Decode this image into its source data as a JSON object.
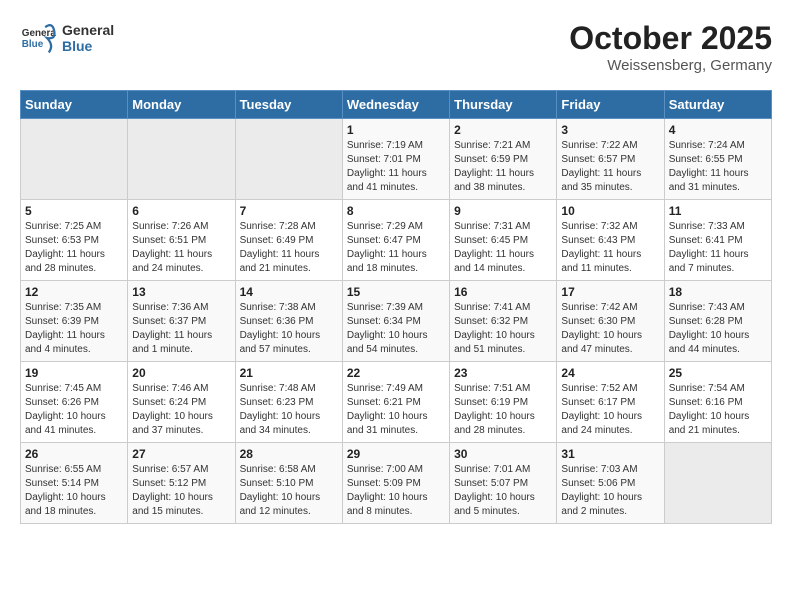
{
  "header": {
    "logo_line1": "General",
    "logo_line2": "Blue",
    "month": "October 2025",
    "location": "Weissensberg, Germany"
  },
  "weekdays": [
    "Sunday",
    "Monday",
    "Tuesday",
    "Wednesday",
    "Thursday",
    "Friday",
    "Saturday"
  ],
  "weeks": [
    [
      {
        "day": "",
        "info": ""
      },
      {
        "day": "",
        "info": ""
      },
      {
        "day": "",
        "info": ""
      },
      {
        "day": "1",
        "info": "Sunrise: 7:19 AM\nSunset: 7:01 PM\nDaylight: 11 hours and 41 minutes."
      },
      {
        "day": "2",
        "info": "Sunrise: 7:21 AM\nSunset: 6:59 PM\nDaylight: 11 hours and 38 minutes."
      },
      {
        "day": "3",
        "info": "Sunrise: 7:22 AM\nSunset: 6:57 PM\nDaylight: 11 hours and 35 minutes."
      },
      {
        "day": "4",
        "info": "Sunrise: 7:24 AM\nSunset: 6:55 PM\nDaylight: 11 hours and 31 minutes."
      }
    ],
    [
      {
        "day": "5",
        "info": "Sunrise: 7:25 AM\nSunset: 6:53 PM\nDaylight: 11 hours and 28 minutes."
      },
      {
        "day": "6",
        "info": "Sunrise: 7:26 AM\nSunset: 6:51 PM\nDaylight: 11 hours and 24 minutes."
      },
      {
        "day": "7",
        "info": "Sunrise: 7:28 AM\nSunset: 6:49 PM\nDaylight: 11 hours and 21 minutes."
      },
      {
        "day": "8",
        "info": "Sunrise: 7:29 AM\nSunset: 6:47 PM\nDaylight: 11 hours and 18 minutes."
      },
      {
        "day": "9",
        "info": "Sunrise: 7:31 AM\nSunset: 6:45 PM\nDaylight: 11 hours and 14 minutes."
      },
      {
        "day": "10",
        "info": "Sunrise: 7:32 AM\nSunset: 6:43 PM\nDaylight: 11 hours and 11 minutes."
      },
      {
        "day": "11",
        "info": "Sunrise: 7:33 AM\nSunset: 6:41 PM\nDaylight: 11 hours and 7 minutes."
      }
    ],
    [
      {
        "day": "12",
        "info": "Sunrise: 7:35 AM\nSunset: 6:39 PM\nDaylight: 11 hours and 4 minutes."
      },
      {
        "day": "13",
        "info": "Sunrise: 7:36 AM\nSunset: 6:37 PM\nDaylight: 11 hours and 1 minute."
      },
      {
        "day": "14",
        "info": "Sunrise: 7:38 AM\nSunset: 6:36 PM\nDaylight: 10 hours and 57 minutes."
      },
      {
        "day": "15",
        "info": "Sunrise: 7:39 AM\nSunset: 6:34 PM\nDaylight: 10 hours and 54 minutes."
      },
      {
        "day": "16",
        "info": "Sunrise: 7:41 AM\nSunset: 6:32 PM\nDaylight: 10 hours and 51 minutes."
      },
      {
        "day": "17",
        "info": "Sunrise: 7:42 AM\nSunset: 6:30 PM\nDaylight: 10 hours and 47 minutes."
      },
      {
        "day": "18",
        "info": "Sunrise: 7:43 AM\nSunset: 6:28 PM\nDaylight: 10 hours and 44 minutes."
      }
    ],
    [
      {
        "day": "19",
        "info": "Sunrise: 7:45 AM\nSunset: 6:26 PM\nDaylight: 10 hours and 41 minutes."
      },
      {
        "day": "20",
        "info": "Sunrise: 7:46 AM\nSunset: 6:24 PM\nDaylight: 10 hours and 37 minutes."
      },
      {
        "day": "21",
        "info": "Sunrise: 7:48 AM\nSunset: 6:23 PM\nDaylight: 10 hours and 34 minutes."
      },
      {
        "day": "22",
        "info": "Sunrise: 7:49 AM\nSunset: 6:21 PM\nDaylight: 10 hours and 31 minutes."
      },
      {
        "day": "23",
        "info": "Sunrise: 7:51 AM\nSunset: 6:19 PM\nDaylight: 10 hours and 28 minutes."
      },
      {
        "day": "24",
        "info": "Sunrise: 7:52 AM\nSunset: 6:17 PM\nDaylight: 10 hours and 24 minutes."
      },
      {
        "day": "25",
        "info": "Sunrise: 7:54 AM\nSunset: 6:16 PM\nDaylight: 10 hours and 21 minutes."
      }
    ],
    [
      {
        "day": "26",
        "info": "Sunrise: 6:55 AM\nSunset: 5:14 PM\nDaylight: 10 hours and 18 minutes."
      },
      {
        "day": "27",
        "info": "Sunrise: 6:57 AM\nSunset: 5:12 PM\nDaylight: 10 hours and 15 minutes."
      },
      {
        "day": "28",
        "info": "Sunrise: 6:58 AM\nSunset: 5:10 PM\nDaylight: 10 hours and 12 minutes."
      },
      {
        "day": "29",
        "info": "Sunrise: 7:00 AM\nSunset: 5:09 PM\nDaylight: 10 hours and 8 minutes."
      },
      {
        "day": "30",
        "info": "Sunrise: 7:01 AM\nSunset: 5:07 PM\nDaylight: 10 hours and 5 minutes."
      },
      {
        "day": "31",
        "info": "Sunrise: 7:03 AM\nSunset: 5:06 PM\nDaylight: 10 hours and 2 minutes."
      },
      {
        "day": "",
        "info": ""
      }
    ]
  ]
}
